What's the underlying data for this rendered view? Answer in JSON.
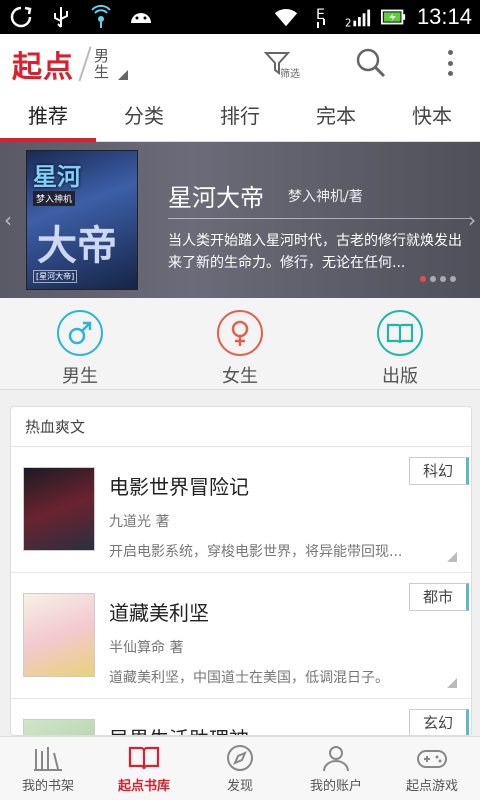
{
  "status_bar": {
    "time": "13:14",
    "icons": [
      "sync-icon",
      "usb-icon",
      "wifi-hotspot-icon",
      "android-icon",
      "wifi-icon",
      "edge-signal-icon",
      "cell-signal-icon",
      "battery-charging-icon"
    ]
  },
  "header": {
    "logo": "起点",
    "gender": "男生",
    "filter_label": "筛选"
  },
  "tabs": [
    {
      "label": "推荐",
      "active": true
    },
    {
      "label": "分类",
      "active": false
    },
    {
      "label": "排行",
      "active": false
    },
    {
      "label": "完本",
      "active": false
    },
    {
      "label": "快本",
      "active": false
    }
  ],
  "banner": {
    "title": "星河大帝",
    "author": "梦入神机/著",
    "description": "当人类开始踏入星河时代，古老的修行就焕发出来了新的生命力。修行，无论在任何...",
    "cover_title": "星河",
    "cover_subtitle": "梦入神机",
    "cover_big": "大帝",
    "cover_tag": "[星河大帝]"
  },
  "categories": [
    {
      "label": "男生",
      "icon": "male-icon",
      "color": "#2bb6d9"
    },
    {
      "label": "女生",
      "icon": "female-icon",
      "color": "#e4604d"
    },
    {
      "label": "出版",
      "icon": "book-icon",
      "color": "#20b7a8"
    }
  ],
  "hot_section": {
    "title": "热血爽文",
    "books": [
      {
        "title": "电影世界冒险记",
        "author": "九道光 著",
        "desc": "开启电影系统，穿梭电影世界，将异能带回现...",
        "tag": "科幻"
      },
      {
        "title": "道藏美利坚",
        "author": "半仙算命 著",
        "desc": "道藏美利坚，中国道士在美国，低调混日子。",
        "tag": "都市"
      },
      {
        "title": "异界生活助理神",
        "author": "",
        "desc": "",
        "tag": "玄幻"
      }
    ]
  },
  "bottom_nav": [
    {
      "label": "我的书架",
      "icon": "bookshelf-icon",
      "active": false
    },
    {
      "label": "起点书库",
      "icon": "open-book-icon",
      "active": true
    },
    {
      "label": "发现",
      "icon": "compass-icon",
      "active": false
    },
    {
      "label": "我的账户",
      "icon": "user-icon",
      "active": false
    },
    {
      "label": "起点游戏",
      "icon": "gamepad-icon",
      "active": false
    }
  ],
  "colors": {
    "brand_red": "#d8202f",
    "tag_accent": "#5fb8c9"
  }
}
